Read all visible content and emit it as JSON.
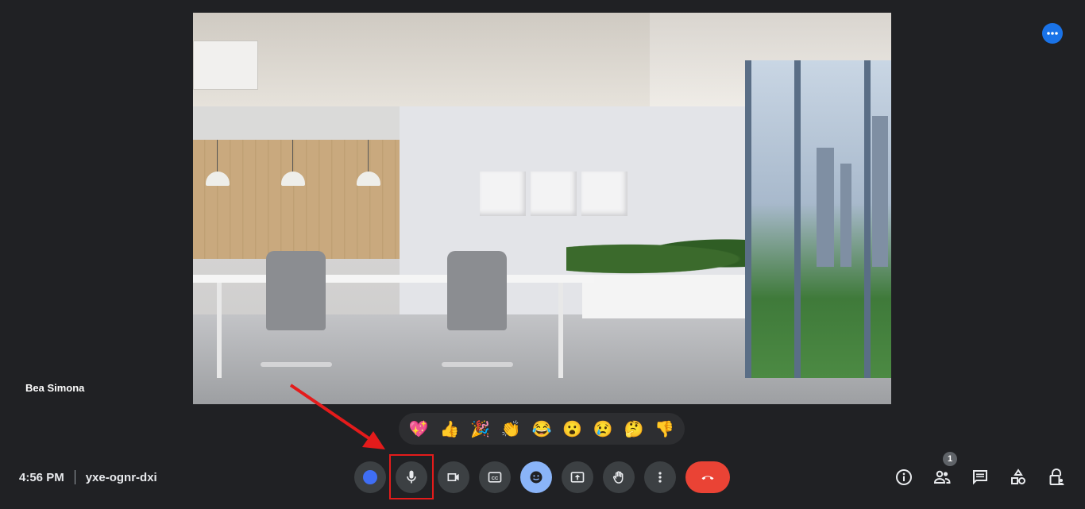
{
  "meeting": {
    "time": "4:56 PM",
    "code": "yxe-ognr-dxi",
    "participant_name": "Bea Simona",
    "participant_count": "1"
  },
  "reactions": [
    "💖",
    "👍",
    "🎉",
    "👏",
    "😂",
    "😮",
    "😢",
    "🤔",
    "👎"
  ],
  "colors": {
    "background": "#202124",
    "control_button": "#3c4043",
    "end_call": "#ea4335",
    "reaction_active": "#8ab4f8",
    "avatar_dot": "#3f6ef5",
    "more_button": "#1a73e8",
    "annotation": "#e41b1b"
  },
  "controls": {
    "items": [
      "avatar-dot",
      "microphone",
      "camera",
      "captions",
      "reactions",
      "present",
      "raise-hand",
      "more-options",
      "end-call"
    ]
  },
  "right_controls": {
    "items": [
      "meeting-info",
      "people",
      "chat",
      "activities",
      "host-controls"
    ]
  }
}
